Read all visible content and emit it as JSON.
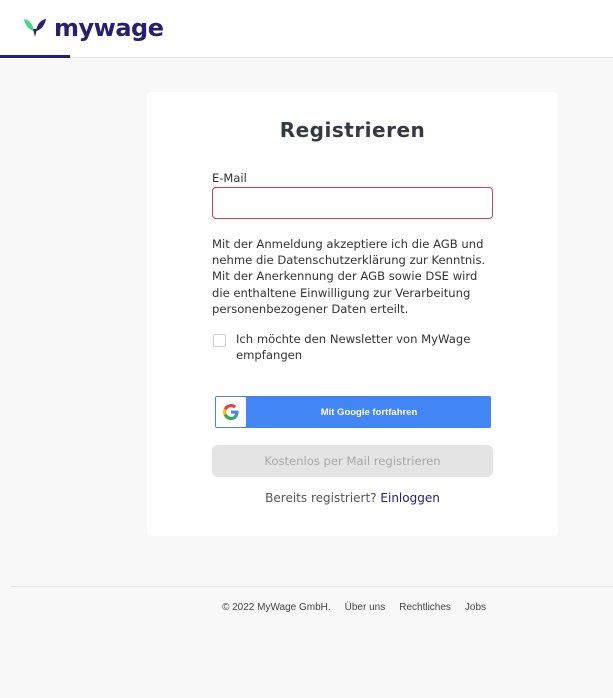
{
  "header": {
    "logo_text": "mywage",
    "brand_color": "#27206e",
    "accent_color": "#3ddc84"
  },
  "form": {
    "title": "Registrieren",
    "email_label": "E-Mail",
    "email_value": "",
    "email_placeholder": "",
    "error_border_color": "#e0384c",
    "legal_text": "Mit der Anmeldung akzeptiere ich die AGB und nehme die Datenschutzerklärung zur Kenntnis. Mit der Anerkennung der AGB sowie DSE wird die enthaltene Einwilligung zur Verarbeitung personenbezogener Daten erteilt.",
    "newsletter_label": "Ich möchte den Newsletter von MyWage empfangen",
    "newsletter_checked": false,
    "google_button_label": "Mit Google fortfahren",
    "google_button_color": "#4285f4",
    "mail_button_label": "Kostenlos per Mail registrieren",
    "already_registered_text": "Bereits registriert?",
    "login_link_label": "Einloggen"
  },
  "footer": {
    "copyright": "© 2022 MyWage GmbH.",
    "links": [
      "Über uns",
      "Rechtliches",
      "Jobs"
    ]
  }
}
